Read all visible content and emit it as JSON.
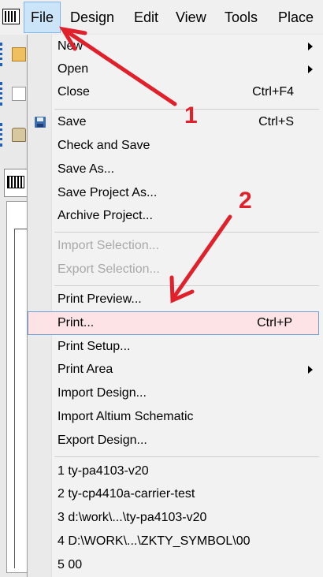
{
  "menubar": {
    "items": [
      {
        "label": "File"
      },
      {
        "label": "Design"
      },
      {
        "label": "Edit"
      },
      {
        "label": "View"
      },
      {
        "label": "Tools"
      },
      {
        "label": "Place"
      }
    ]
  },
  "file_menu": {
    "items": [
      {
        "label": "New",
        "submenu": true
      },
      {
        "label": "Open",
        "submenu": true
      },
      {
        "label": "Close",
        "shortcut": "Ctrl+F4"
      },
      {
        "label": "Save",
        "shortcut": "Ctrl+S",
        "icon": "save-icon"
      },
      {
        "label": "Check and Save"
      },
      {
        "label": "Save As..."
      },
      {
        "label": "Save Project As..."
      },
      {
        "label": "Archive Project..."
      },
      {
        "label": "Import Selection...",
        "disabled": true
      },
      {
        "label": "Export Selection...",
        "disabled": true
      },
      {
        "label": "Print Preview..."
      },
      {
        "label": "Print...",
        "shortcut": "Ctrl+P",
        "highlighted": true
      },
      {
        "label": "Print Setup..."
      },
      {
        "label": "Print Area",
        "submenu": true
      },
      {
        "label": "Import Design..."
      },
      {
        "label": "Import Altium Schematic"
      },
      {
        "label": "Export Design..."
      },
      {
        "label": "1 ty-pa4103-v20"
      },
      {
        "label": "2 ty-cp4410a-carrier-test"
      },
      {
        "label": "3 d:\\work\\...\\ty-pa4103-v20"
      },
      {
        "label": "4 D:\\WORK\\...\\ZKTY_SYMBOL\\00"
      },
      {
        "label": "5 00"
      }
    ]
  },
  "annotations": {
    "step1": "1",
    "step2": "2",
    "arrow_color": "#e0202a"
  },
  "colors": {
    "menu_active_bg": "#cce4f7",
    "highlight_bg": "#fde3e5",
    "highlight_border": "#6f9fd8"
  }
}
